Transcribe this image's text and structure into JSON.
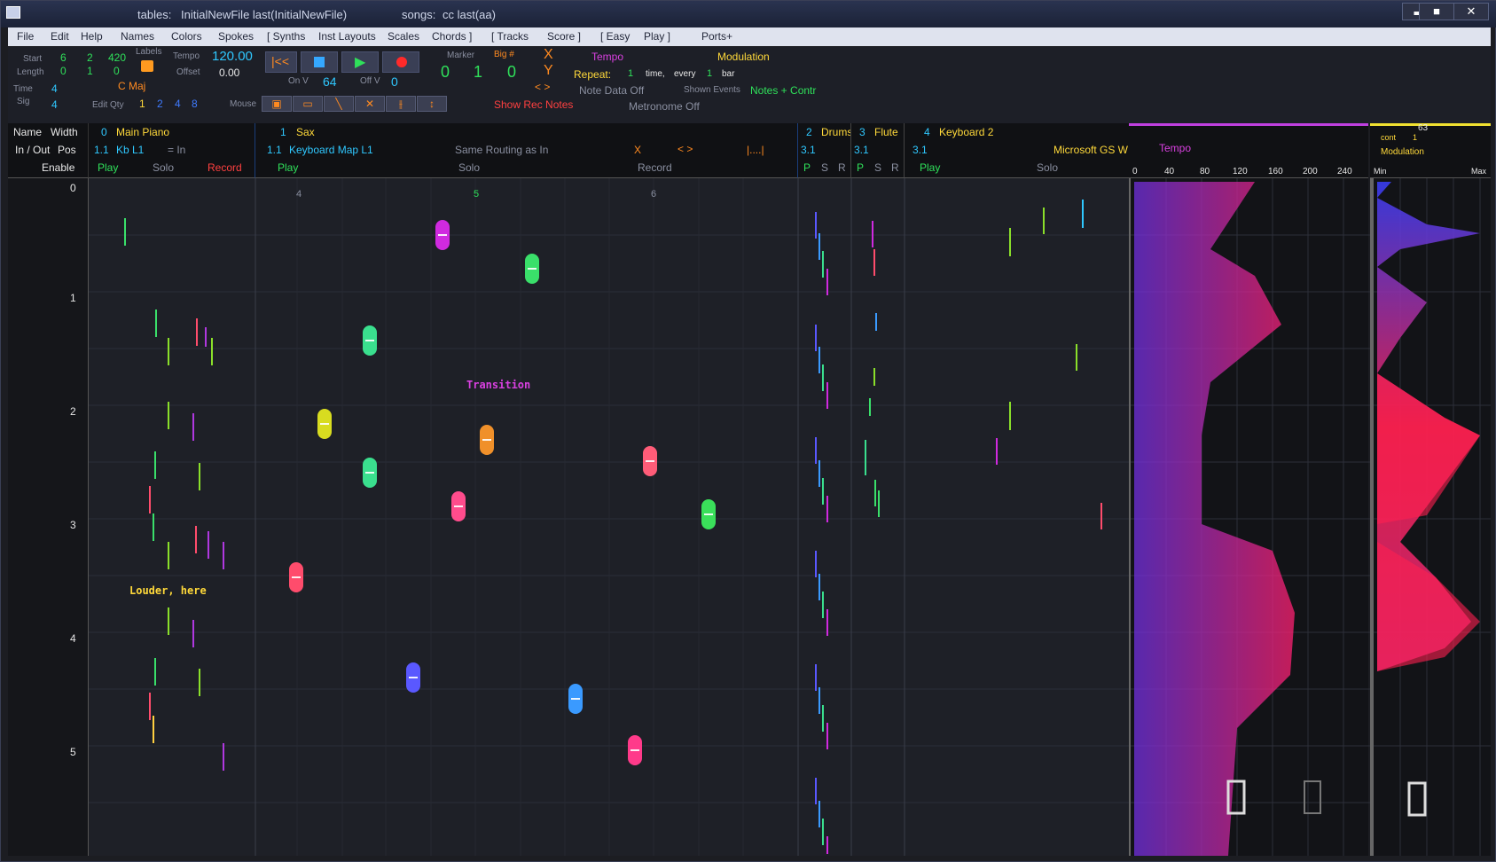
{
  "titlebar": {
    "tables_label": "tables:",
    "tables_value": "InitialNewFile  last(InitialNewFile)",
    "songs_label": "songs:",
    "songs_value": "cc   last(aa)",
    "min": "▬",
    "max": "■",
    "close": "✕"
  },
  "menu": {
    "items": [
      "File",
      "Edit",
      "Help",
      "Names",
      "Colors",
      "Spokes",
      "[ Synths",
      "Inst Layouts",
      "Scales",
      "Chords ]",
      "[ Tracks",
      "Score ]",
      "[ Easy",
      "Play ]",
      "Ports+"
    ]
  },
  "controls": {
    "start_label": "Start",
    "start_vals": [
      "6",
      "2",
      "420"
    ],
    "length_label": "Length",
    "length_vals": [
      "0",
      "1",
      "0"
    ],
    "labels_label": "Labels",
    "tempo_label": "Tempo",
    "tempo_value": "120.00",
    "offset_label": "Offset",
    "offset_value": "0.00",
    "time_label": "Time",
    "time_value": "4",
    "sig_label": "Sig",
    "sig_value": "4",
    "key_value": "C Maj",
    "editqty_label": "Edit Qty",
    "editqty_vals": [
      "1",
      "2",
      "4",
      "8"
    ],
    "mouse_label": "Mouse",
    "onv_label": "On V",
    "onv_value": "64",
    "offv_label": "Off V",
    "offv_value": "0",
    "marker_label": "Marker",
    "bignum_label": "Big #",
    "marker_vals": [
      "0",
      "1",
      "0"
    ],
    "x_label": "X",
    "y_label": "Y",
    "arrows": "<   >",
    "show_rec": "Show Rec Notes",
    "tempo_title": "Tempo",
    "modulation_title": "Modulation",
    "repeat_label": "Repeat:",
    "repeat_value": "1",
    "time_word": "time,",
    "every_word": "every",
    "every_value": "1",
    "bar_word": "bar",
    "note_data": "Note Data Off",
    "shown_events_label": "Shown Events",
    "shown_events_value": "Notes + Contr",
    "metronome": "Metronome Off"
  },
  "header": {
    "name": "Name",
    "width": "Width",
    "inout": "In / Out",
    "pos": "Pos",
    "enable": "Enable",
    "t0": {
      "num": "0",
      "name": "Main Piano",
      "pos": "1.1",
      "map": "Kb  L1",
      "routing": "= In",
      "play": "Play",
      "solo": "Solo",
      "record": "Record"
    },
    "t1": {
      "num": "1",
      "name": "Sax",
      "pos": "1.1",
      "map": "Keyboard Map  L1",
      "routing": "Same Routing as In",
      "x": "X",
      "arrows": "<   >",
      "dots": "|....|",
      "play": "Play",
      "solo": "Solo",
      "record": "Record"
    },
    "t2": {
      "num": "2",
      "name": "Drums",
      "pos": "3.1",
      "p": "P",
      "s": "S",
      "r": "R"
    },
    "t3": {
      "num": "3",
      "name": "Flute",
      "pos": "3.1",
      "p": "P",
      "s": "S",
      "r": "R"
    },
    "t4": {
      "num": "4",
      "name": "Keyboard 2",
      "pos": "3.1",
      "synth": "Microsoft GS W",
      "play": "Play",
      "solo": "Solo"
    }
  },
  "tempo_panel": {
    "title": "Tempo",
    "ticks": [
      "0",
      "40",
      "80",
      "120",
      "160",
      "200",
      "240"
    ]
  },
  "mod_panel": {
    "cont_label": "cont",
    "cont_value": "1",
    "top_value": "63",
    "title": "Modulation",
    "min": "Min",
    "max": "Max"
  },
  "grid": {
    "rows": [
      "0",
      "1",
      "2",
      "3",
      "4",
      "5"
    ],
    "cols": [
      "4",
      "5",
      "6"
    ],
    "annot1": "Louder, here",
    "annot2": "Transition"
  },
  "colors": {
    "green": "#2fe05a",
    "yellow": "#ffd93a",
    "cyan": "#2fc8ff",
    "magenta": "#d940e0",
    "orange": "#ff8a20"
  }
}
